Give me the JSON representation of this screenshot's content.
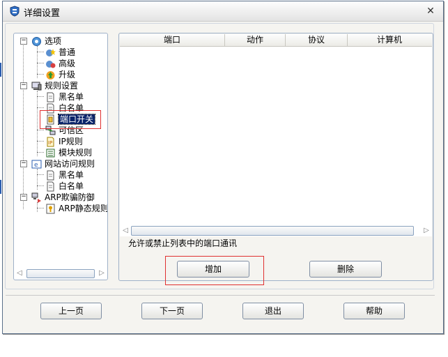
{
  "window": {
    "title": "详细设置"
  },
  "tree": {
    "items": [
      {
        "label": "选项",
        "icon": "options-globe-icon"
      },
      {
        "label": "普通",
        "icon": "star-gear-icon"
      },
      {
        "label": "高级",
        "icon": "advanced-gear-icon"
      },
      {
        "label": "升级",
        "icon": "upgrade-icon"
      },
      {
        "label": "规则设置",
        "icon": "rules-computer-icon"
      },
      {
        "label": "黑名单",
        "icon": "document-icon"
      },
      {
        "label": "白名单",
        "icon": "document-icon"
      },
      {
        "label": "端口开关",
        "icon": "port-switch-icon"
      },
      {
        "label": "可信区",
        "icon": "trusted-zone-icon"
      },
      {
        "label": "IP规则",
        "icon": "ip-rule-icon"
      },
      {
        "label": "模块规则",
        "icon": "module-list-icon"
      },
      {
        "label": "网站访问规则",
        "icon": "browser-e-icon"
      },
      {
        "label": "黑名单",
        "icon": "document-icon"
      },
      {
        "label": "白名单",
        "icon": "document-icon"
      },
      {
        "label": "ARP欺骗防御",
        "icon": "arp-network-icon"
      },
      {
        "label": "ARP静态规则",
        "icon": "arp-static-icon"
      }
    ],
    "selected": "端口开关"
  },
  "list": {
    "columns": [
      "端口",
      "动作",
      "协议",
      "计算机"
    ]
  },
  "description": "允许或禁止列表中的端口通讯",
  "buttons": {
    "add": "增加",
    "delete": "删除",
    "prev": "上一页",
    "next": "下一页",
    "exit": "退出",
    "help": "帮助"
  },
  "colors": {
    "selection": "#0a246a",
    "highlight_box": "#e03030",
    "panel_border": "#9fb1c8"
  }
}
